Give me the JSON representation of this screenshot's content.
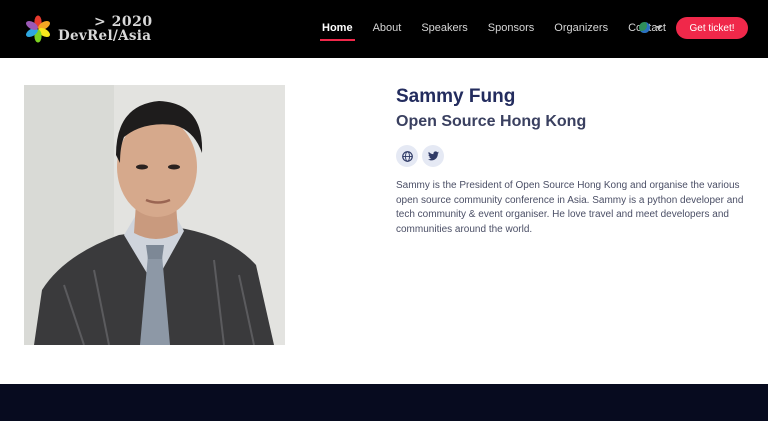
{
  "brand": {
    "year": "> 2020",
    "name": "DevRel/Asia",
    "petal_colors": [
      "#e63a2e",
      "#f5a623",
      "#f8e71c",
      "#7ed321",
      "#2ea7e0",
      "#9b59b6"
    ]
  },
  "nav": {
    "items": [
      {
        "label": "Home",
        "active": true
      },
      {
        "label": "About",
        "active": false
      },
      {
        "label": "Speakers",
        "active": false
      },
      {
        "label": "Sponsors",
        "active": false
      },
      {
        "label": "Organizers",
        "active": false
      },
      {
        "label": "Contact",
        "active": false
      }
    ],
    "language_icon": "globe-icon",
    "cta_label": "Get ticket!",
    "accent_color": "#f0284a"
  },
  "speaker": {
    "name": "Sammy Fung",
    "organization": "Open Source Hong Kong",
    "socials": [
      {
        "icon": "website-globe-icon"
      },
      {
        "icon": "twitter-icon"
      }
    ],
    "bio": "Sammy is the President of Open Source Hong Kong and organise the various open source community conference in Asia. Sammy is a python developer and tech community & event organiser. He love travel and meet developers and communities around the world."
  }
}
